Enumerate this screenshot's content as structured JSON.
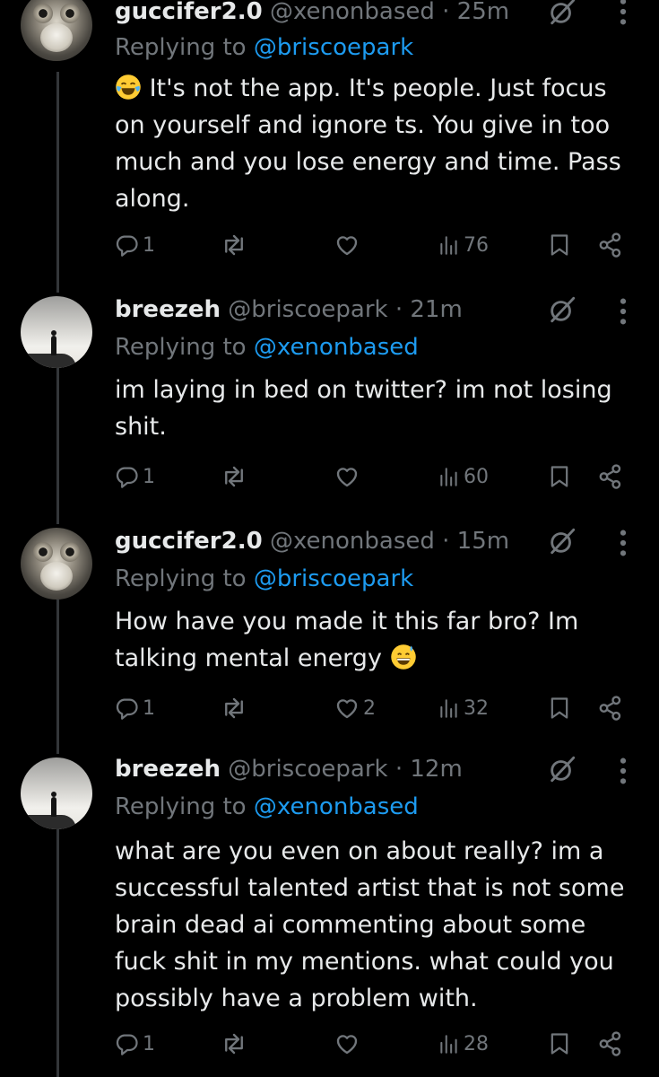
{
  "tweets": [
    {
      "name": "guccifer2.0",
      "handle": "@xenonbased",
      "time": "· 25m",
      "replying_label": "Replying to",
      "replying_handle": "@briscoepark",
      "body": "It's not the app. It's people. Just focus on yourself and ignore ts. You give in too much and you lose energy and time. Pass along.",
      "lead_emoji": "face-with-tears-of-joy",
      "replies": "1",
      "reposts": "",
      "likes": "",
      "views": "76",
      "avatar": "owl-figurine-avatar"
    },
    {
      "name": "breezeh",
      "handle": "@briscoepark",
      "time": "· 21m",
      "replying_label": "Replying to",
      "replying_handle": "@xenonbased",
      "body": "im laying in bed on twitter? im not losing shit.",
      "replies": "1",
      "reposts": "",
      "likes": "",
      "views": "60",
      "avatar": "silhouette-on-cliff-avatar"
    },
    {
      "name": "guccifer2.0",
      "handle": "@xenonbased",
      "time": "· 15m",
      "replying_label": "Replying to",
      "replying_handle": "@briscoepark",
      "body": "How have you made it this far bro? Im talking mental energy",
      "trail_emoji": "grinning-face-with-sweat",
      "replies": "1",
      "reposts": "",
      "likes": "2",
      "views": "32",
      "avatar": "owl-figurine-avatar"
    },
    {
      "name": "breezeh",
      "handle": "@briscoepark",
      "time": "· 12m",
      "replying_label": "Replying to",
      "replying_handle": "@xenonbased",
      "body": "what are you even on about really? im a successful talented artist that is not some brain dead ai commenting about some fuck shit in my mentions. what could you possibly have a problem with.",
      "replies": "1",
      "reposts": "",
      "likes": "",
      "views": "28",
      "avatar": "silhouette-on-cliff-avatar"
    }
  ],
  "colors": {
    "background": "#000000",
    "text": "#e7e9ea",
    "muted": "#71767b",
    "link": "#1d9bf0",
    "thread_line": "#333639"
  }
}
